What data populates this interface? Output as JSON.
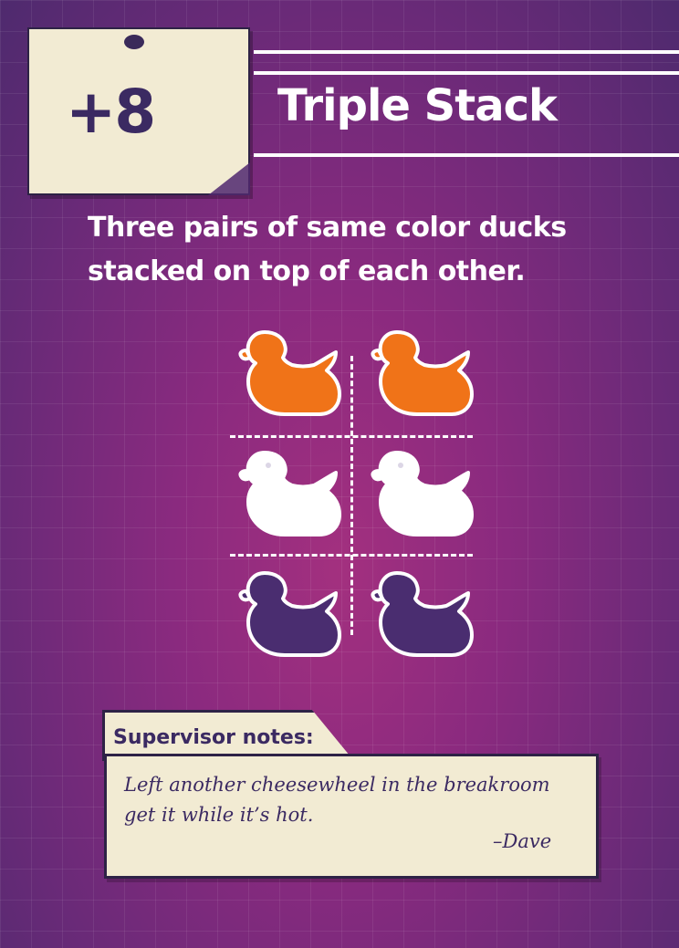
{
  "card": {
    "points": "+8",
    "title": "Triple Stack",
    "description": "Three pairs of same color ducks stacked on top of each other."
  },
  "ducks": {
    "rows": [
      {
        "color": "#f07318",
        "name": "orange"
      },
      {
        "color": "#ffffff",
        "name": "white"
      },
      {
        "color": "#4a2d70",
        "name": "purple"
      }
    ]
  },
  "supervisor": {
    "label": "Supervisor notes:",
    "text": "Left another cheesewheel in the breakroom get it while it’s hot.",
    "signature": "–Dave"
  }
}
